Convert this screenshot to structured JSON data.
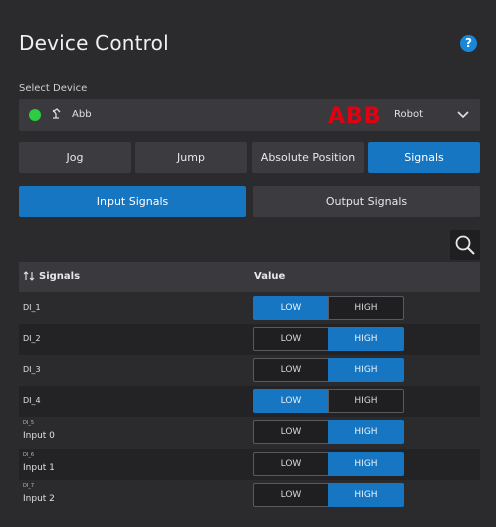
{
  "header": {
    "title": "Device Control",
    "help_icon": "?"
  },
  "device": {
    "select_label": "Select Device",
    "status_color": "#2ecc40",
    "name": "Abb",
    "brand_logo": "ABB",
    "type": "Robot"
  },
  "tabs": [
    {
      "label": "Jog",
      "active": false
    },
    {
      "label": "Jump",
      "active": false
    },
    {
      "label": "Absolute Position",
      "active": false
    },
    {
      "label": "Signals",
      "active": true
    }
  ],
  "subtabs": [
    {
      "label": "Input Signals",
      "active": true
    },
    {
      "label": "Output Signals",
      "active": false
    }
  ],
  "table": {
    "columns": [
      "Signals",
      "Value"
    ],
    "toggle_labels": {
      "low": "LOW",
      "high": "HIGH"
    },
    "rows": [
      {
        "name": "DI_1",
        "sub": "",
        "value": "LOW"
      },
      {
        "name": "DI_2",
        "sub": "",
        "value": "HIGH"
      },
      {
        "name": "DI_3",
        "sub": "",
        "value": "HIGH"
      },
      {
        "name": "DI_4",
        "sub": "",
        "value": "LOW"
      },
      {
        "name": "Input 0",
        "sub": "DI_5",
        "value": "HIGH"
      },
      {
        "name": "Input 1",
        "sub": "DI_6",
        "value": "HIGH"
      },
      {
        "name": "Input 2",
        "sub": "DI_7",
        "value": "HIGH"
      }
    ]
  },
  "colors": {
    "accent": "#1776c2",
    "background": "#2b2b2e",
    "brand_red": "#e3000f"
  }
}
